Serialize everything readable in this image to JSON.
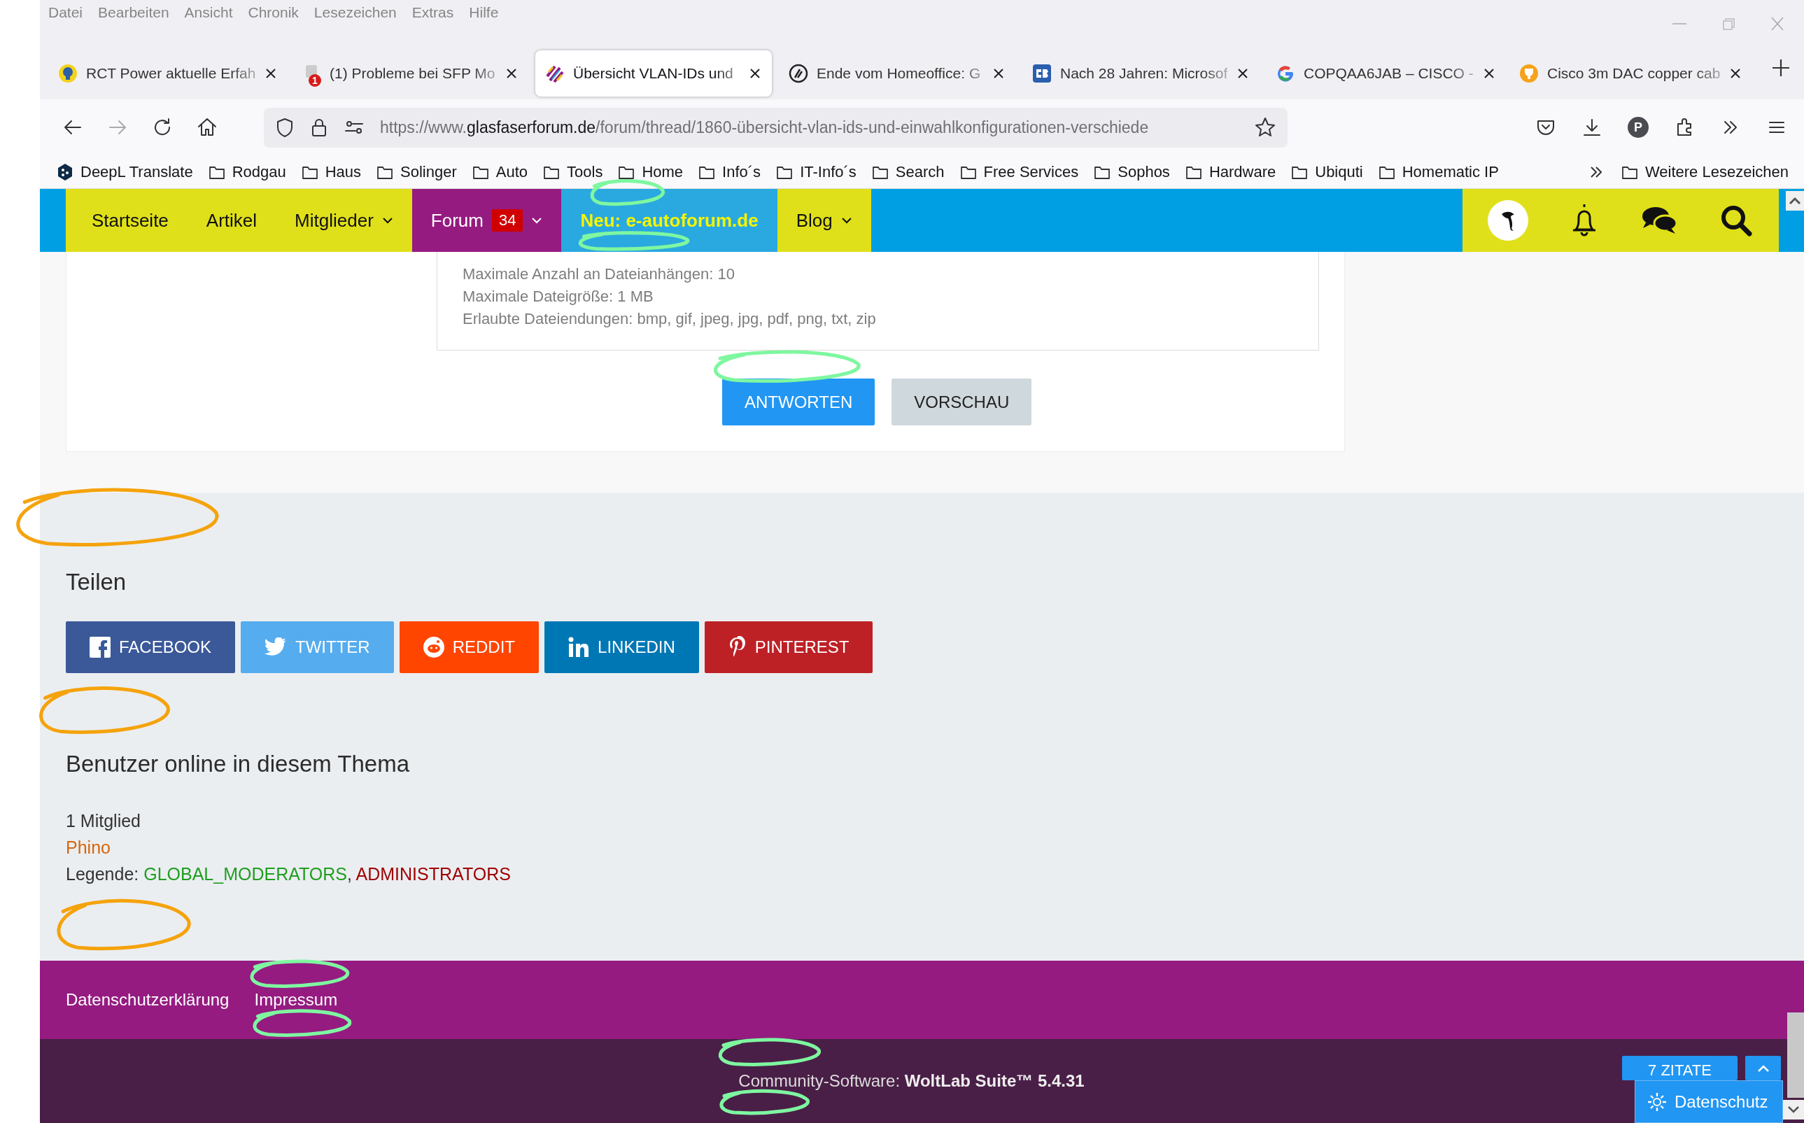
{
  "menu_bar": [
    "Datei",
    "Bearbeiten",
    "Ansicht",
    "Chronik",
    "Lesezeichen",
    "Extras",
    "Hilfe"
  ],
  "tabs": [
    {
      "title": "RCT Power aktuelle Erfah",
      "kind": "bulb",
      "selected": false
    },
    {
      "title": "(1) Probleme bei SFP Mo",
      "kind": "badge",
      "badge": "1",
      "selected": false
    },
    {
      "title": "Übersicht VLAN-IDs und",
      "kind": "stripes",
      "selected": true
    },
    {
      "title": "Ende vom Homeoffice: G",
      "kind": "swirl",
      "selected": false
    },
    {
      "title": "Nach 28 Jahren: Microsof",
      "kind": "square",
      "selected": false
    },
    {
      "title": "COPQAA6JAB – CISCO -",
      "kind": "google",
      "selected": false
    },
    {
      "title": "Cisco 3m DAC copper cab",
      "kind": "trophy",
      "selected": false
    }
  ],
  "address_bar": {
    "url_scheme": "https://www.",
    "url_domain": "glasfaserforum.de",
    "url_path": "/forum/thread/1860-übersicht-vlan-ids-und-einwahlkonfigurationen-verschiede"
  },
  "profile_initial": "P",
  "bookmarks": [
    {
      "label": "DeepL Translate",
      "kind": "site"
    },
    {
      "label": "Rodgau",
      "kind": "folder"
    },
    {
      "label": "Haus",
      "kind": "folder"
    },
    {
      "label": "Solinger",
      "kind": "folder"
    },
    {
      "label": "Auto",
      "kind": "folder"
    },
    {
      "label": "Tools",
      "kind": "folder"
    },
    {
      "label": "Home",
      "kind": "folder"
    },
    {
      "label": "Info´s",
      "kind": "folder"
    },
    {
      "label": "IT-Info´s",
      "kind": "folder"
    },
    {
      "label": "Search",
      "kind": "folder"
    },
    {
      "label": "Free Services",
      "kind": "folder"
    },
    {
      "label": "Sophos",
      "kind": "folder"
    },
    {
      "label": "Hardware",
      "kind": "folder"
    },
    {
      "label": "Ubiquti",
      "kind": "folder"
    },
    {
      "label": "Homematic IP",
      "kind": "folder"
    }
  ],
  "other_bookmarks": "Weitere Lesezeichen",
  "site_nav": [
    {
      "label": "Startseite",
      "kind": "link",
      "color": "#e0e01a",
      "has_menu": false
    },
    {
      "label": "Artikel",
      "kind": "link",
      "color": "#e0e01a",
      "has_menu": false
    },
    {
      "label": "Mitglieder",
      "kind": "link",
      "color": "#e0e01a",
      "has_menu": true
    },
    {
      "label": "Forum",
      "kind": "link",
      "color": "#951b81",
      "has_menu": true,
      "badge": "34"
    },
    {
      "label": "Neu: e-autoforum.de",
      "kind": "promo",
      "color": "#2aa9e0",
      "has_menu": false
    },
    {
      "label": "Blog",
      "kind": "link",
      "color": "#e0e01a",
      "has_menu": true
    }
  ],
  "attachment_info": [
    "Maximale Anzahl an Dateianhängen: 10",
    "Maximale Dateigröße: 1 MB",
    "Erlaubte Dateiendungen: bmp, gif, jpeg, jpg, pdf, png, txt, zip"
  ],
  "form_buttons": [
    {
      "label": "ANTWORTEN",
      "kind": "primary"
    },
    {
      "label": "VORSCHAU",
      "kind": "secondary"
    }
  ],
  "share": {
    "heading": "Teilen",
    "buttons": [
      {
        "label": "FACEBOOK",
        "kind": "facebook",
        "color": "#3b5998"
      },
      {
        "label": "TWITTER",
        "kind": "twitter",
        "color": "#55acee"
      },
      {
        "label": "REDDIT",
        "kind": "reddit",
        "color": "#ff4500"
      },
      {
        "label": "LINKEDIN",
        "kind": "linkedin",
        "color": "#0077b5"
      },
      {
        "label": "PINTEREST",
        "kind": "pinterest",
        "color": "#bd2126"
      }
    ]
  },
  "online": {
    "heading": "Benutzer online in diesem Thema",
    "count": "1 Mitglied",
    "users": [
      {
        "name": "Phino",
        "color": "#d4670e"
      }
    ],
    "legend": {
      "label": "Legende:",
      "separator": ",",
      "groups": [
        {
          "name": "GLOBAL_MODERATORS",
          "color": "#1f9e1f"
        },
        {
          "name": "ADMINISTRATORS",
          "color": "#a00000"
        }
      ]
    }
  },
  "footer_links": [
    "Datenschutzerklärung",
    "Impressum"
  ],
  "copyright": "Community-Software: **WoltLab Suite™ 5.4.31**",
  "quote_button": "7 ZITATE",
  "privacy_button": "Datenschutz",
  "annotation_marks": [
    {
      "color": "#7ef7a0"
    },
    {
      "color": "#7ef7a0"
    },
    {
      "color": "#7ef7a0"
    },
    {
      "color": "#7ef7a0"
    },
    {
      "color": "#7ef7a0"
    },
    {
      "color": "#7ef7a0"
    },
    {
      "color": "#7ef7a0"
    },
    {
      "color": "#f5a30c"
    },
    {
      "color": "#f5a30c"
    },
    {
      "color": "#f5a30c"
    }
  ]
}
